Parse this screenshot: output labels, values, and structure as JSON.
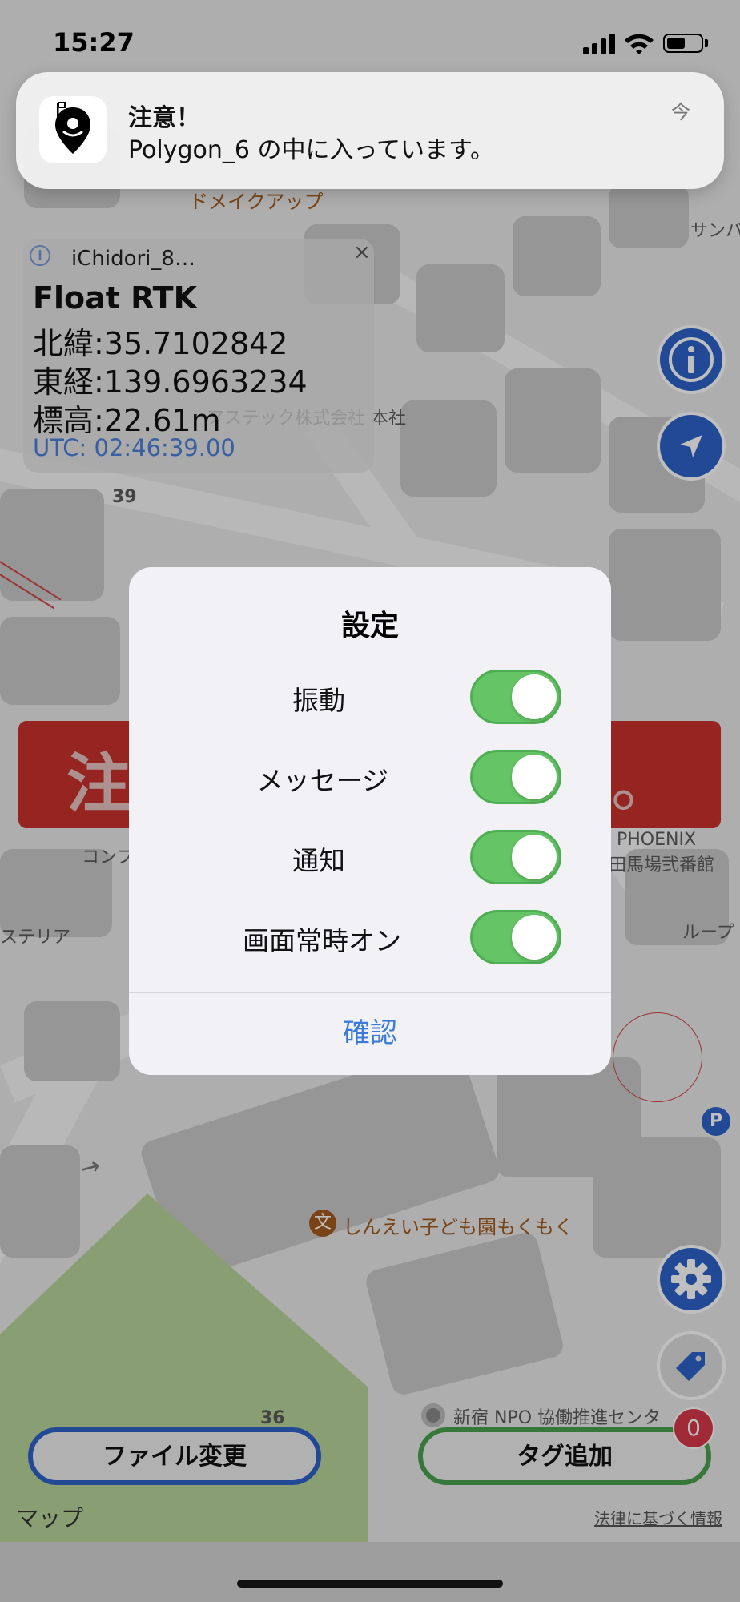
{
  "status_bar": {
    "time": "15:27"
  },
  "notification": {
    "title": "注意！",
    "body": "Polygon_6 の中に入っています。",
    "time": "今"
  },
  "map": {
    "labels": {
      "poi_top": "ドメイクアップ",
      "sanba": "サンバ",
      "company": "アステック株式会社 本社",
      "n39": "39",
      "phoenix": "PHOENIX",
      "phoenix2": "田馬場弐番館",
      "konpu": "コンプ",
      "esteria": "ステリア",
      "loop": "ループ",
      "kindergarten": "しんえい子ども園もくもく",
      "npo": "新宿 NPO 協働推進センタ",
      "n36": "36",
      "parking": "P"
    }
  },
  "info_panel": {
    "device": "iChidori_8…",
    "close": "×",
    "fix": "Float RTK",
    "lat": "北緯:35.7102842",
    "lon": "東経:139.6963234",
    "alt": "標高:22.61m",
    "utc": "UTC: 02:46:39.00"
  },
  "warning_banner": {
    "text": "注意",
    "end": "。"
  },
  "dialog": {
    "title": "設定",
    "options": [
      {
        "label": "振動",
        "on": true
      },
      {
        "label": "メッセージ",
        "on": true
      },
      {
        "label": "通知",
        "on": true
      },
      {
        "label": "画面常時オン",
        "on": true
      }
    ],
    "confirm": "確認"
  },
  "buttons": {
    "file_change": "ファイル変更",
    "add_tag": "タグ追加",
    "tag_count": "0"
  },
  "footer": {
    "maps": "マップ",
    "legal": "法律に基づく情報"
  },
  "colors": {
    "accent_blue": "#2e62c9",
    "toggle_green": "#65c466",
    "warning_red": "#c8312c",
    "confirm_blue": "#3a7ad8"
  },
  "icons": [
    "app-icon",
    "info-icon",
    "locate-arrow-icon",
    "gear-icon",
    "tag-icon",
    "apple-logo-icon",
    "signal-icon",
    "wifi-icon",
    "battery-icon"
  ]
}
